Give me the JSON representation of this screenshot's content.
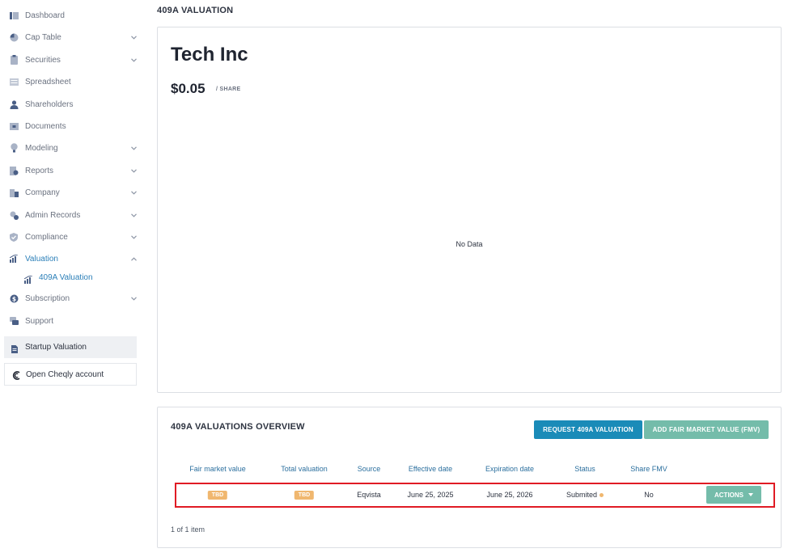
{
  "sidebar": {
    "items": [
      {
        "label": "Dashboard",
        "icon": "dashboard-icon",
        "has_chevron": false
      },
      {
        "label": "Cap Table",
        "icon": "pie-chart-icon",
        "has_chevron": true
      },
      {
        "label": "Securities",
        "icon": "clipboard-icon",
        "has_chevron": true
      },
      {
        "label": "Spreadsheet",
        "icon": "spreadsheet-icon",
        "has_chevron": false
      },
      {
        "label": "Shareholders",
        "icon": "user-icon",
        "has_chevron": false
      },
      {
        "label": "Documents",
        "icon": "folder-icon",
        "has_chevron": false
      },
      {
        "label": "Modeling",
        "icon": "lightbulb-icon",
        "has_chevron": true
      },
      {
        "label": "Reports",
        "icon": "reports-icon",
        "has_chevron": true
      },
      {
        "label": "Company",
        "icon": "building-icon",
        "has_chevron": true
      },
      {
        "label": "Admin Records",
        "icon": "gears-icon",
        "has_chevron": true
      },
      {
        "label": "Compliance",
        "icon": "shield-check-icon",
        "has_chevron": true
      },
      {
        "label": "Valuation",
        "icon": "bar-chart-icon",
        "has_chevron": true,
        "expanded": true
      },
      {
        "label": "409A Valuation",
        "icon": "bar-chart-icon",
        "sub": true
      },
      {
        "label": "Subscription",
        "icon": "dollar-circle-icon",
        "has_chevron": true
      },
      {
        "label": "Support",
        "icon": "support-icon",
        "has_chevron": false
      }
    ],
    "startup_valuation": "Startup Valuation",
    "open_cheqly": "Open Cheqly account"
  },
  "page": {
    "title": "409A VALUATION"
  },
  "summary": {
    "company_name": "Tech Inc",
    "price": "$0.05",
    "price_unit": "/ SHARE",
    "chart_empty_text": "No Data"
  },
  "overview": {
    "title": "409A VALUATIONS OVERVIEW",
    "request_button": "REQUEST 409A VALUATION",
    "add_fmv_button": "ADD FAIR MARKET VALUE (FMV)",
    "columns": [
      "Fair market value",
      "Total valuation",
      "Source",
      "Effective date",
      "Expiration date",
      "Status",
      "Share FMV"
    ],
    "rows": [
      {
        "fair_market_value": "TBD",
        "total_valuation": "TBD",
        "source": "Eqvista",
        "effective_date": "June 25, 2025",
        "expiration_date": "June 25, 2026",
        "status": "Submited",
        "share_fmv": "No",
        "actions_label": "ACTIONS"
      }
    ],
    "pager": "1 of 1 item"
  },
  "colors": {
    "accent_blue": "#1a8bb8",
    "accent_teal": "#74bcaa",
    "badge_orange": "#f0b76f",
    "active_link": "#2b7fb8",
    "highlight_red": "#e01b24"
  }
}
